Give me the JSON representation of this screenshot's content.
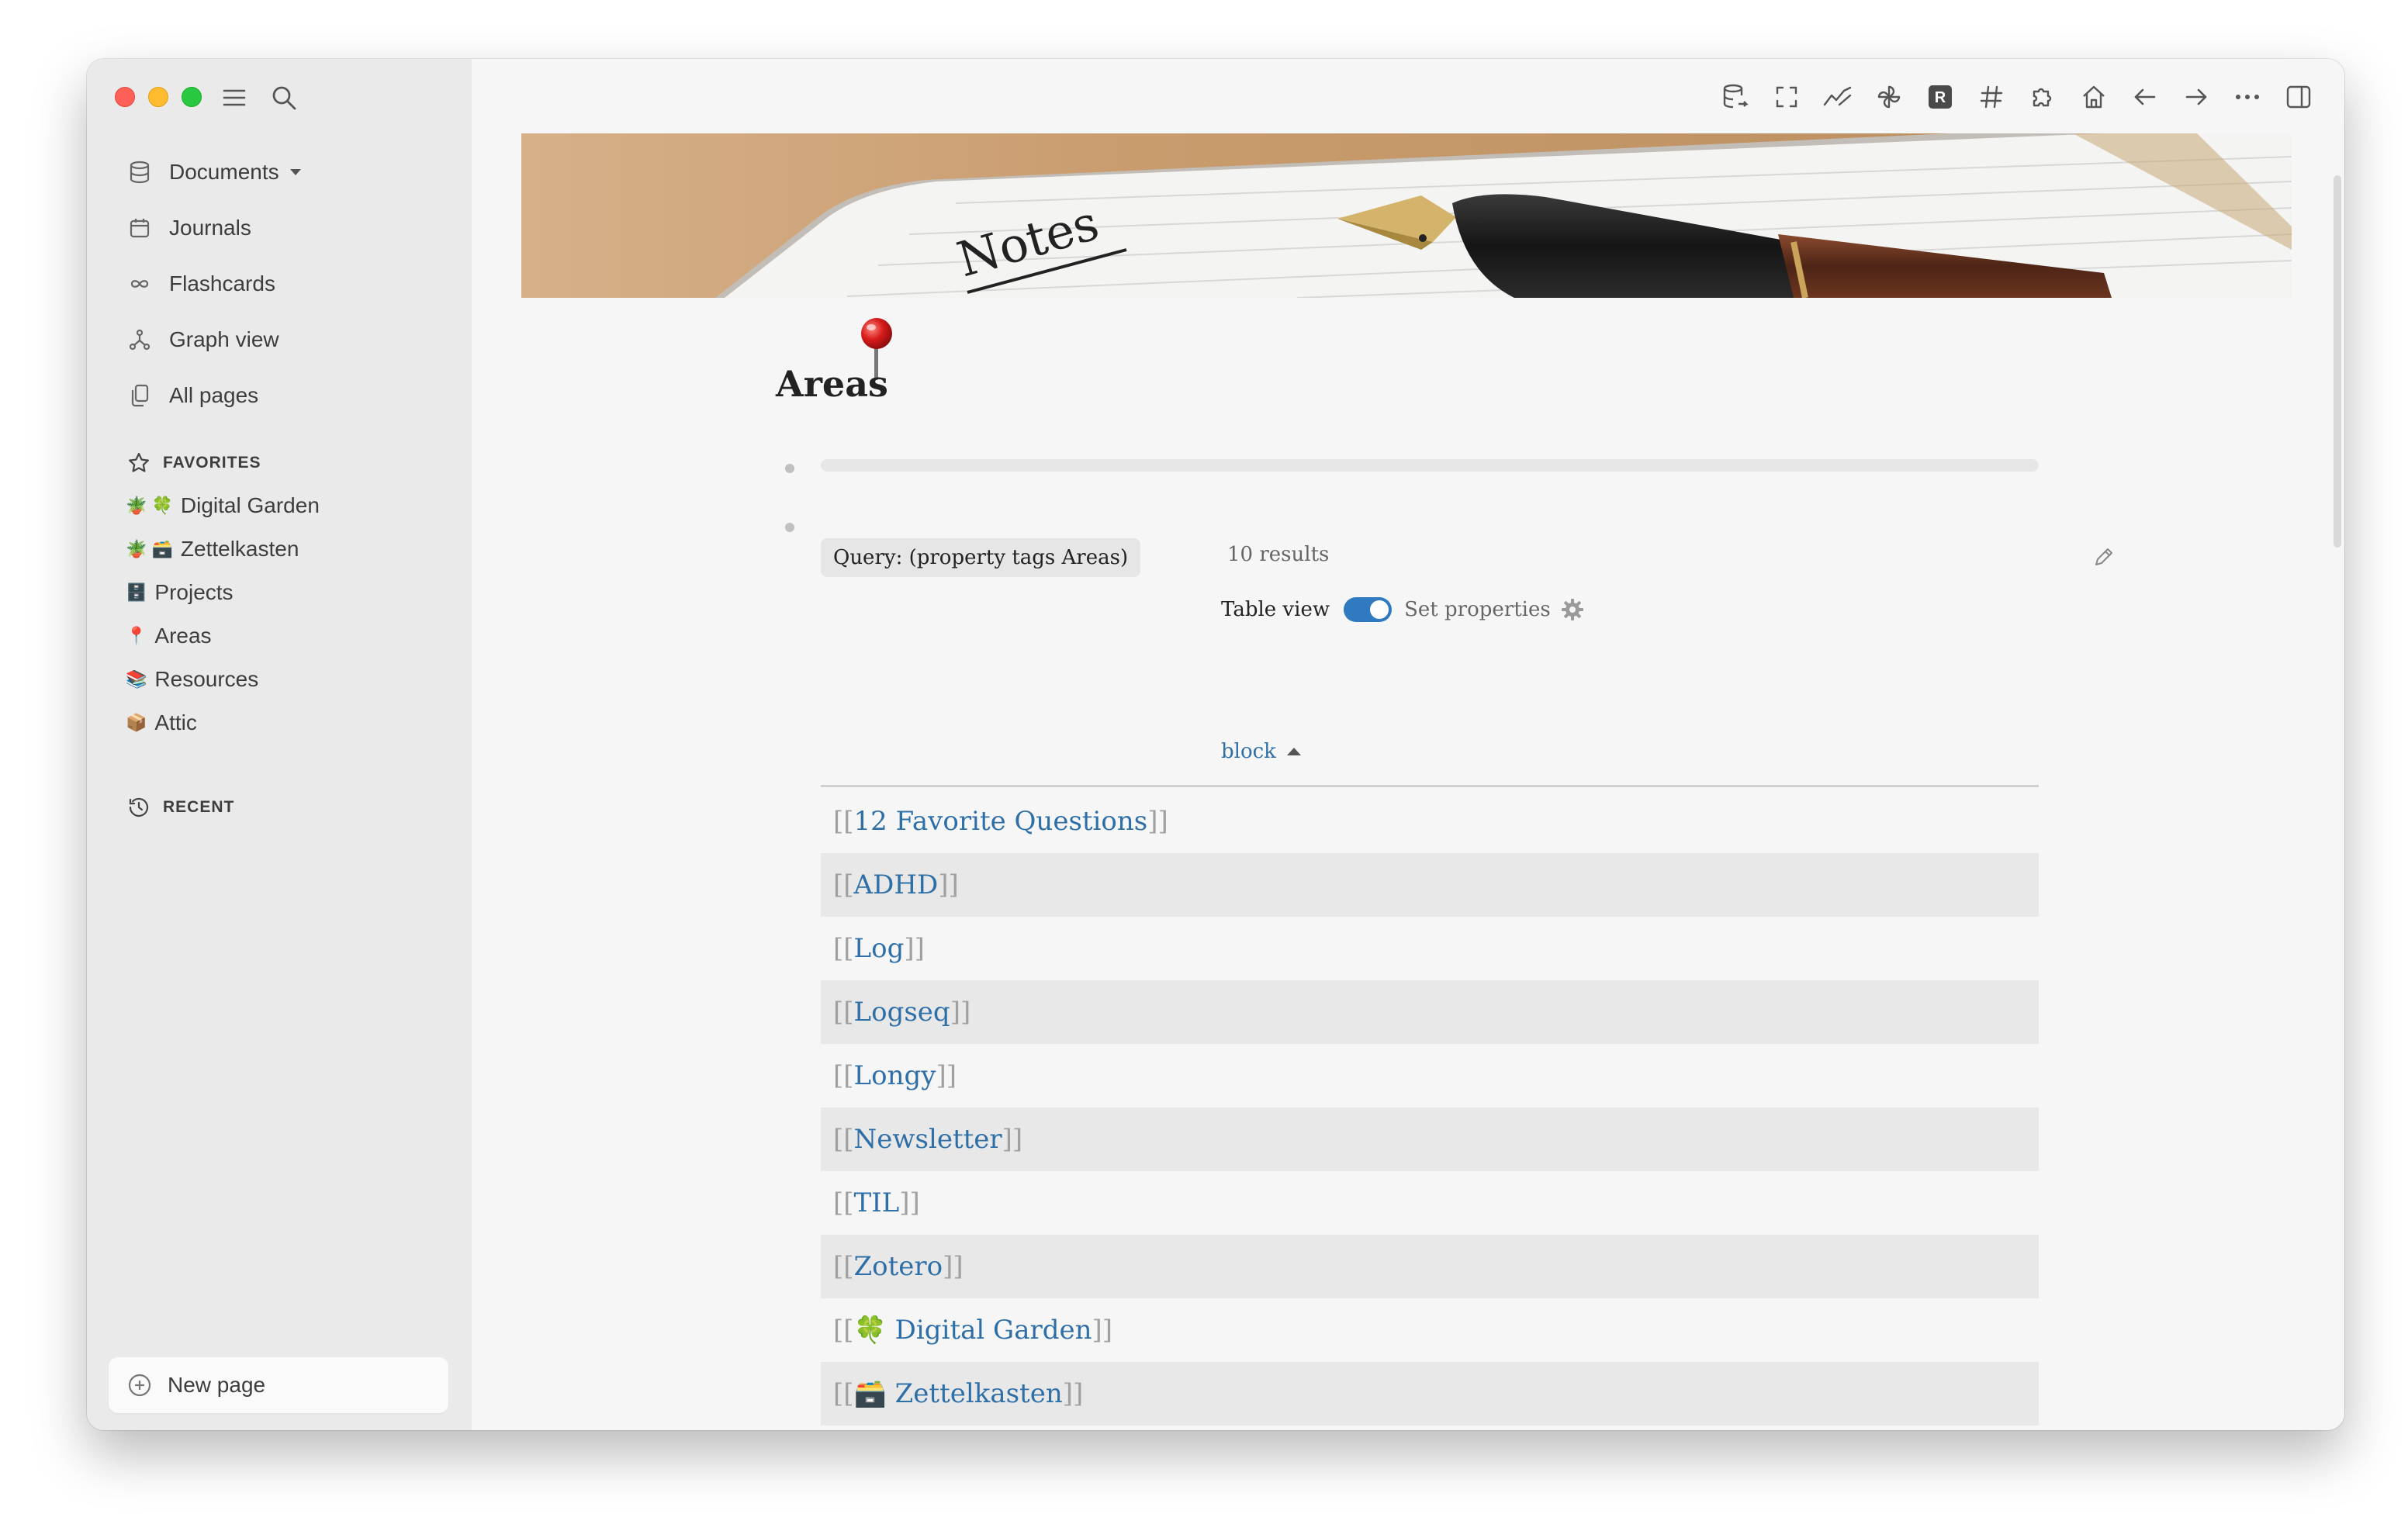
{
  "sidebar": {
    "nav": [
      {
        "label": "Documents",
        "icon": "database-icon",
        "has_caret": true
      },
      {
        "label": "Journals",
        "icon": "calendar-icon"
      },
      {
        "label": "Flashcards",
        "icon": "infinity-icon"
      },
      {
        "label": "Graph view",
        "icon": "graph-icon"
      },
      {
        "label": "All pages",
        "icon": "pages-icon"
      }
    ],
    "favorites_title": "FAVORITES",
    "favorites": [
      {
        "label": "Digital Garden",
        "emoji": "🪴 🍀"
      },
      {
        "label": "Zettelkasten",
        "emoji": "🪴 🗃️"
      },
      {
        "label": "Projects",
        "emoji": "🗄️"
      },
      {
        "label": "Areas",
        "emoji": "📍"
      },
      {
        "label": "Resources",
        "emoji": "📚"
      },
      {
        "label": "Attic",
        "emoji": "📦"
      }
    ],
    "recent_title": "RECENT",
    "new_page_label": "New page"
  },
  "toolbar": {
    "icons": [
      "database-sync-icon",
      "fullscreen-icon",
      "sparkline-icon",
      "pinwheel-icon",
      "r-logo-icon",
      "hashtag-icon",
      "puzzle-icon",
      "home-icon",
      "arrow-left-icon",
      "arrow-right-icon",
      "more-icon",
      "sidebar-toggle-icon"
    ]
  },
  "cover": {
    "pen_text": "Notes"
  },
  "page": {
    "title": "Areas",
    "query_label": "Query: (property tags Areas)",
    "results_count": "10 results",
    "table_view_label": "Table view",
    "table_view_enabled": true,
    "set_properties_label": "Set properties",
    "column_header": "block",
    "rows": [
      "12 Favorite Questions",
      "ADHD",
      "Log",
      "Logseq",
      "Longy",
      "Newsletter",
      "TIL",
      "Zotero",
      "🍀 Digital Garden",
      "🗃️ Zettelkasten"
    ]
  },
  "colors": {
    "link": "#2f6fa8",
    "toggle": "#2f7ac0",
    "sidebar_bg": "#eaeaea",
    "main_bg": "#f6f6f6"
  }
}
